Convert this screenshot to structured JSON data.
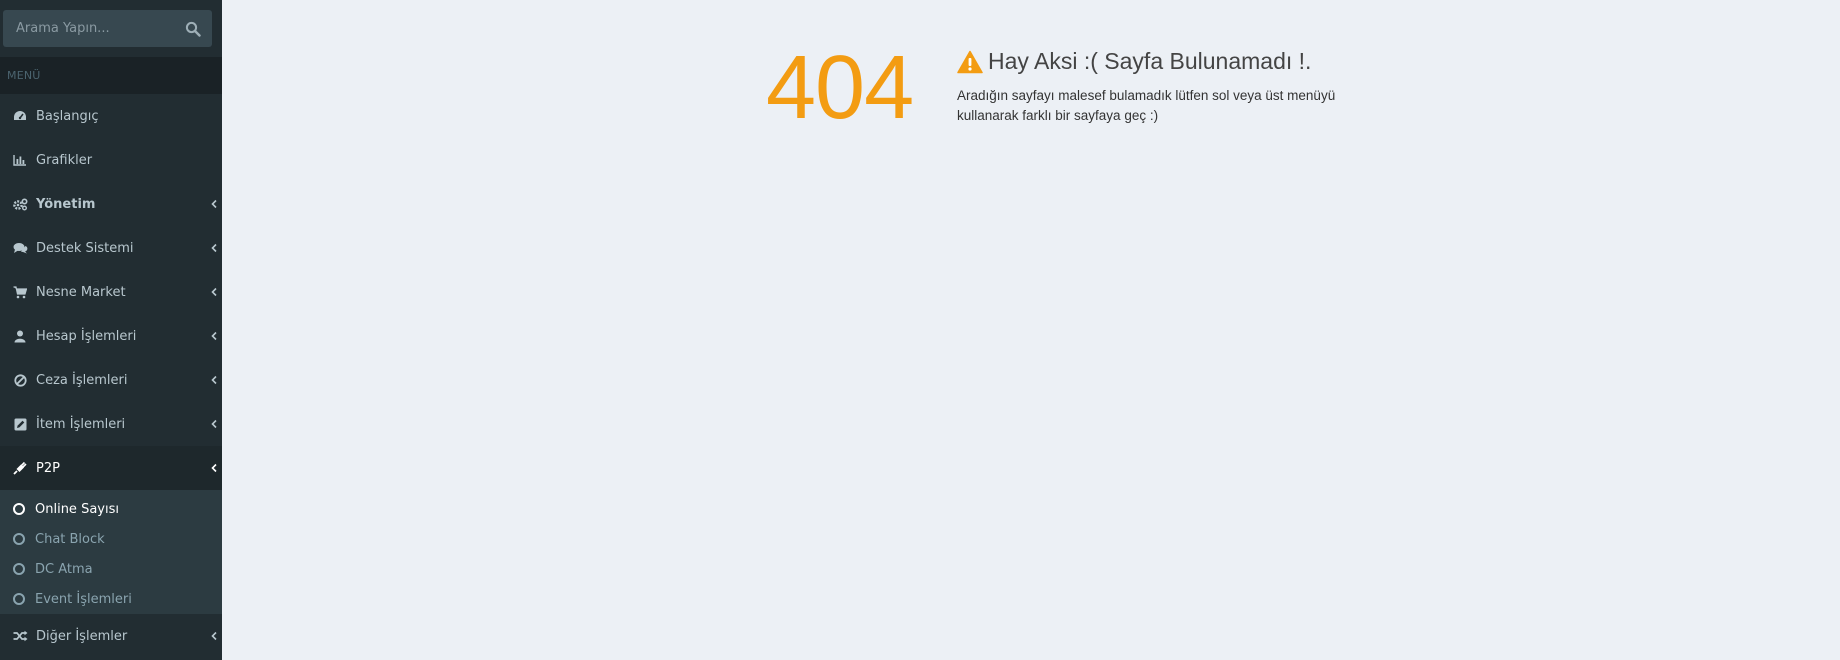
{
  "sidebar": {
    "search": {
      "placeholder": "Arama Yapın..."
    },
    "menu_header": "MENÜ",
    "items": [
      {
        "label": "Başlangıç",
        "icon": "dashboard-icon"
      },
      {
        "label": "Grafikler",
        "icon": "bar-chart-icon"
      },
      {
        "label": "Yönetim",
        "icon": "gears-icon"
      },
      {
        "label": "Destek Sistemi",
        "icon": "comments-icon"
      },
      {
        "label": "Nesne Market",
        "icon": "shopping-cart-icon"
      },
      {
        "label": "Hesap İşlemleri",
        "icon": "user-icon"
      },
      {
        "label": "Ceza İşlemleri",
        "icon": "ban-icon"
      },
      {
        "label": "İtem İşlemleri",
        "icon": "edit-icon"
      },
      {
        "label": "P2P",
        "icon": "plug-icon"
      },
      {
        "label": "Diğer İşlemler",
        "icon": "random-icon"
      }
    ],
    "p2p_submenu": [
      {
        "label": "Online Sayısı"
      },
      {
        "label": "Chat Block"
      },
      {
        "label": "DC Atma"
      },
      {
        "label": "Event İşlemleri"
      }
    ]
  },
  "main": {
    "error_code": "404",
    "title": "Hay Aksi :( Sayfa Bulunamadı !.",
    "message": "Aradığın sayfayı malesef bulamadık lütfen sol veya üst menüyü kullanarak farklı bir sayfaya geç :)"
  },
  "colors": {
    "sidebar_bg": "#222d32",
    "accent": "#f39c12",
    "content_bg": "#ecf0f5"
  }
}
